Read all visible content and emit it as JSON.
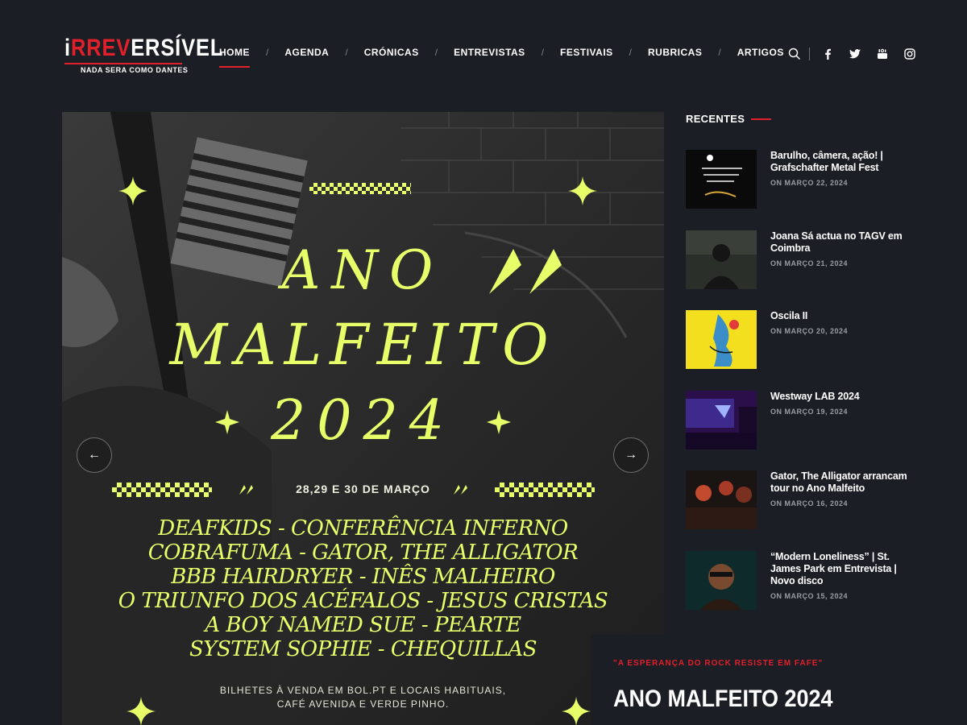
{
  "logo": {
    "main_white_1": "i",
    "main_red": "RREV",
    "main_white_2": "ERSÍVEL",
    "tagline": "NADA SERA COMO DANTES"
  },
  "nav": {
    "items": [
      "HOME",
      "AGENDA",
      "CRÓNICAS",
      "ENTREVISTAS",
      "FESTIVAIS",
      "RUBRICAS",
      "ARTIGOS"
    ],
    "separator": "/",
    "active": "HOME"
  },
  "header_tools": [
    "search-icon",
    "facebook-icon",
    "twitter-icon",
    "youtube-icon",
    "instagram-icon"
  ],
  "hero": {
    "title_lines": [
      "ANO",
      "MALFEITO",
      "2024"
    ],
    "dates": "28,29 E 30 DE MARÇO",
    "lineup": [
      "DEAFKIDS - CONFERÊNCIA INFERNO",
      "COBRAFUMA - GATOR, THE ALLIGATOR",
      "BBB HAIRDRYER - INÊS MALHEIRO",
      "O TRIUNFO DOS ACÉFALOS - JESUS CRISTAS",
      "A BOY NAMED SUE - PEARTE",
      "SYSTEM SOPHIE - CHEQUILLAS"
    ],
    "tickets_line1": "BILHETES À VENDA EM BOL.PT E LOCAIS HABITUAIS,",
    "tickets_line2": "CAFÉ AVENIDA E VERDE PINHO.",
    "prev_arrow": "←",
    "next_arrow": "→"
  },
  "caption": {
    "kicker": "\"A ESPERANÇA DO ROCK RESISTE EM FAFE\"",
    "title": "ANO MALFEITO 2024"
  },
  "sidebar": {
    "heading": "RECENTES",
    "posts": [
      {
        "title": "Barulho, câmera, ação! | Grafschafter Metal Fest",
        "date": "ON MARÇO 22, 2024"
      },
      {
        "title": "Joana Sá actua no TAGV em Coimbra",
        "date": "ON MARÇO 21, 2024"
      },
      {
        "title": "Oscila II",
        "date": "ON MARÇO 20, 2024"
      },
      {
        "title": "Westway LAB 2024",
        "date": "ON MARÇO 19, 2024"
      },
      {
        "title": "Gator, The Alligator arrancam tour no Ano Malfeito",
        "date": "ON MARÇO 16, 2024"
      },
      {
        "title": "“Modern Loneliness” | St. James Park em Entrevista | Novo disco",
        "date": "ON MARÇO 15, 2024"
      }
    ]
  },
  "colors": {
    "background": "#1c1e25",
    "accent": "#e0202a",
    "poster_yellow": "#e8ff6a"
  }
}
